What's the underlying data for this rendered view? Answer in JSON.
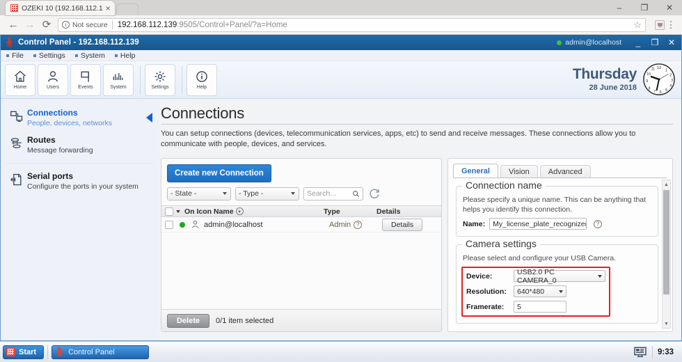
{
  "browser": {
    "tab_title": "OZEKI 10 (192.168.112.1",
    "tab_favicon": "ozeki-grid-icon",
    "close_label": "×",
    "back_label": "←",
    "forward_label": "→",
    "reload_label": "⟳",
    "info_label": "i",
    "security_text": "Not secure",
    "url_main": "192.168.112.139",
    "url_rest": ":9505/Control+Panel/?a=Home",
    "star_label": "☆",
    "menu_label": "⋮",
    "win_minimize": "–",
    "win_maximize": "❐",
    "win_close": "✕"
  },
  "app": {
    "title": "Control Panel - 192.168.112.139",
    "user": "admin@localhost",
    "minimize_label": "_",
    "maximize_label": "❐",
    "close_label": "✕",
    "menu": [
      "File",
      "Settings",
      "System",
      "Help"
    ],
    "ribbon": [
      {
        "label": "Home",
        "icon": "home-icon"
      },
      {
        "label": "Users",
        "icon": "user-icon"
      },
      {
        "label": "Events",
        "icon": "flag-icon"
      },
      {
        "label": "System",
        "icon": "bars-icon"
      },
      {
        "label": "Settings",
        "icon": "gear-icon"
      },
      {
        "label": "Help",
        "icon": "info-icon"
      }
    ],
    "clock": {
      "day": "Thursday",
      "date": "28 June 2018",
      "time": "9:33"
    }
  },
  "sidebar": {
    "items": [
      {
        "title": "Connections",
        "subtitle": "People, devices, networks",
        "icon": "network-icon"
      },
      {
        "title": "Routes",
        "subtitle": "Message forwarding",
        "icon": "route-icon"
      },
      {
        "title": "Serial ports",
        "subtitle": "Configure the ports in your system",
        "icon": "serial-port-icon"
      }
    ]
  },
  "main": {
    "heading": "Connections",
    "description": "You can setup connections (devices, telecommunication services, apps, etc) to send and receive messages. These connections allow you to communicate with people, devices, and services.",
    "list": {
      "create_button": "Create new Connection",
      "state_filter": "- State -",
      "type_filter": "- Type -",
      "search_placeholder": "Search...",
      "search_value": "",
      "refresh_icon": "refresh-icon",
      "columns": [
        "On Icon Name",
        "Type",
        "Details"
      ],
      "rows": [
        {
          "name": "admin@localhost",
          "type": "Admin",
          "details_button": "Details",
          "state": "online",
          "icon": "person-icon"
        }
      ],
      "delete_button": "Delete",
      "selection_text": "0/1 item selected"
    },
    "detail": {
      "tabs": [
        "General",
        "Vision",
        "Advanced"
      ],
      "active_tab": "General",
      "connection_name": {
        "legend": "Connection name",
        "description": "Please specify a unique name. This can be anything that helps you identify this connection.",
        "name_label": "Name:",
        "name_value": "My_license_plate_recognizer_",
        "help_icon": "question-icon"
      },
      "camera_settings": {
        "legend": "Camera settings",
        "description": "Please select and configure your USB Camera.",
        "device_label": "Device:",
        "device_value": "USB2.0 PC CAMERA_0",
        "resolution_label": "Resolution:",
        "resolution_value": "640*480",
        "framerate_label": "Framerate:",
        "framerate_value": "5",
        "highlight_color": "#e8201c"
      }
    }
  },
  "taskbar": {
    "start_label": "Start",
    "window_label": "Control Panel",
    "tray_icon": "display-icon",
    "time": "9:33"
  }
}
